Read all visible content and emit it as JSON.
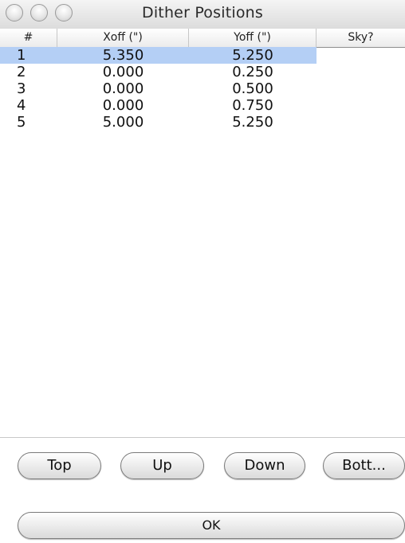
{
  "window": {
    "title": "Dither Positions"
  },
  "table": {
    "columns": [
      "#",
      "Xoff (\")",
      "Yoff (\")",
      "Sky?"
    ],
    "rows": [
      {
        "index": "1",
        "xoff": "5.350",
        "yoff": "5.250",
        "sky": true,
        "selected": true
      },
      {
        "index": "2",
        "xoff": "0.000",
        "yoff": "0.250",
        "sky": false,
        "selected": false
      },
      {
        "index": "3",
        "xoff": "0.000",
        "yoff": "0.500",
        "sky": false,
        "selected": false
      },
      {
        "index": "4",
        "xoff": "0.000",
        "yoff": "0.750",
        "sky": false,
        "selected": false
      },
      {
        "index": "5",
        "xoff": "5.000",
        "yoff": "5.250",
        "sky": true,
        "selected": false
      }
    ]
  },
  "buttons": {
    "top": "Top",
    "up": "Up",
    "down": "Down",
    "bottom": "Bott...",
    "ok": "OK"
  },
  "colors": {
    "selection": "#b4cff5",
    "checkbox_on": "#7fb6f2"
  }
}
